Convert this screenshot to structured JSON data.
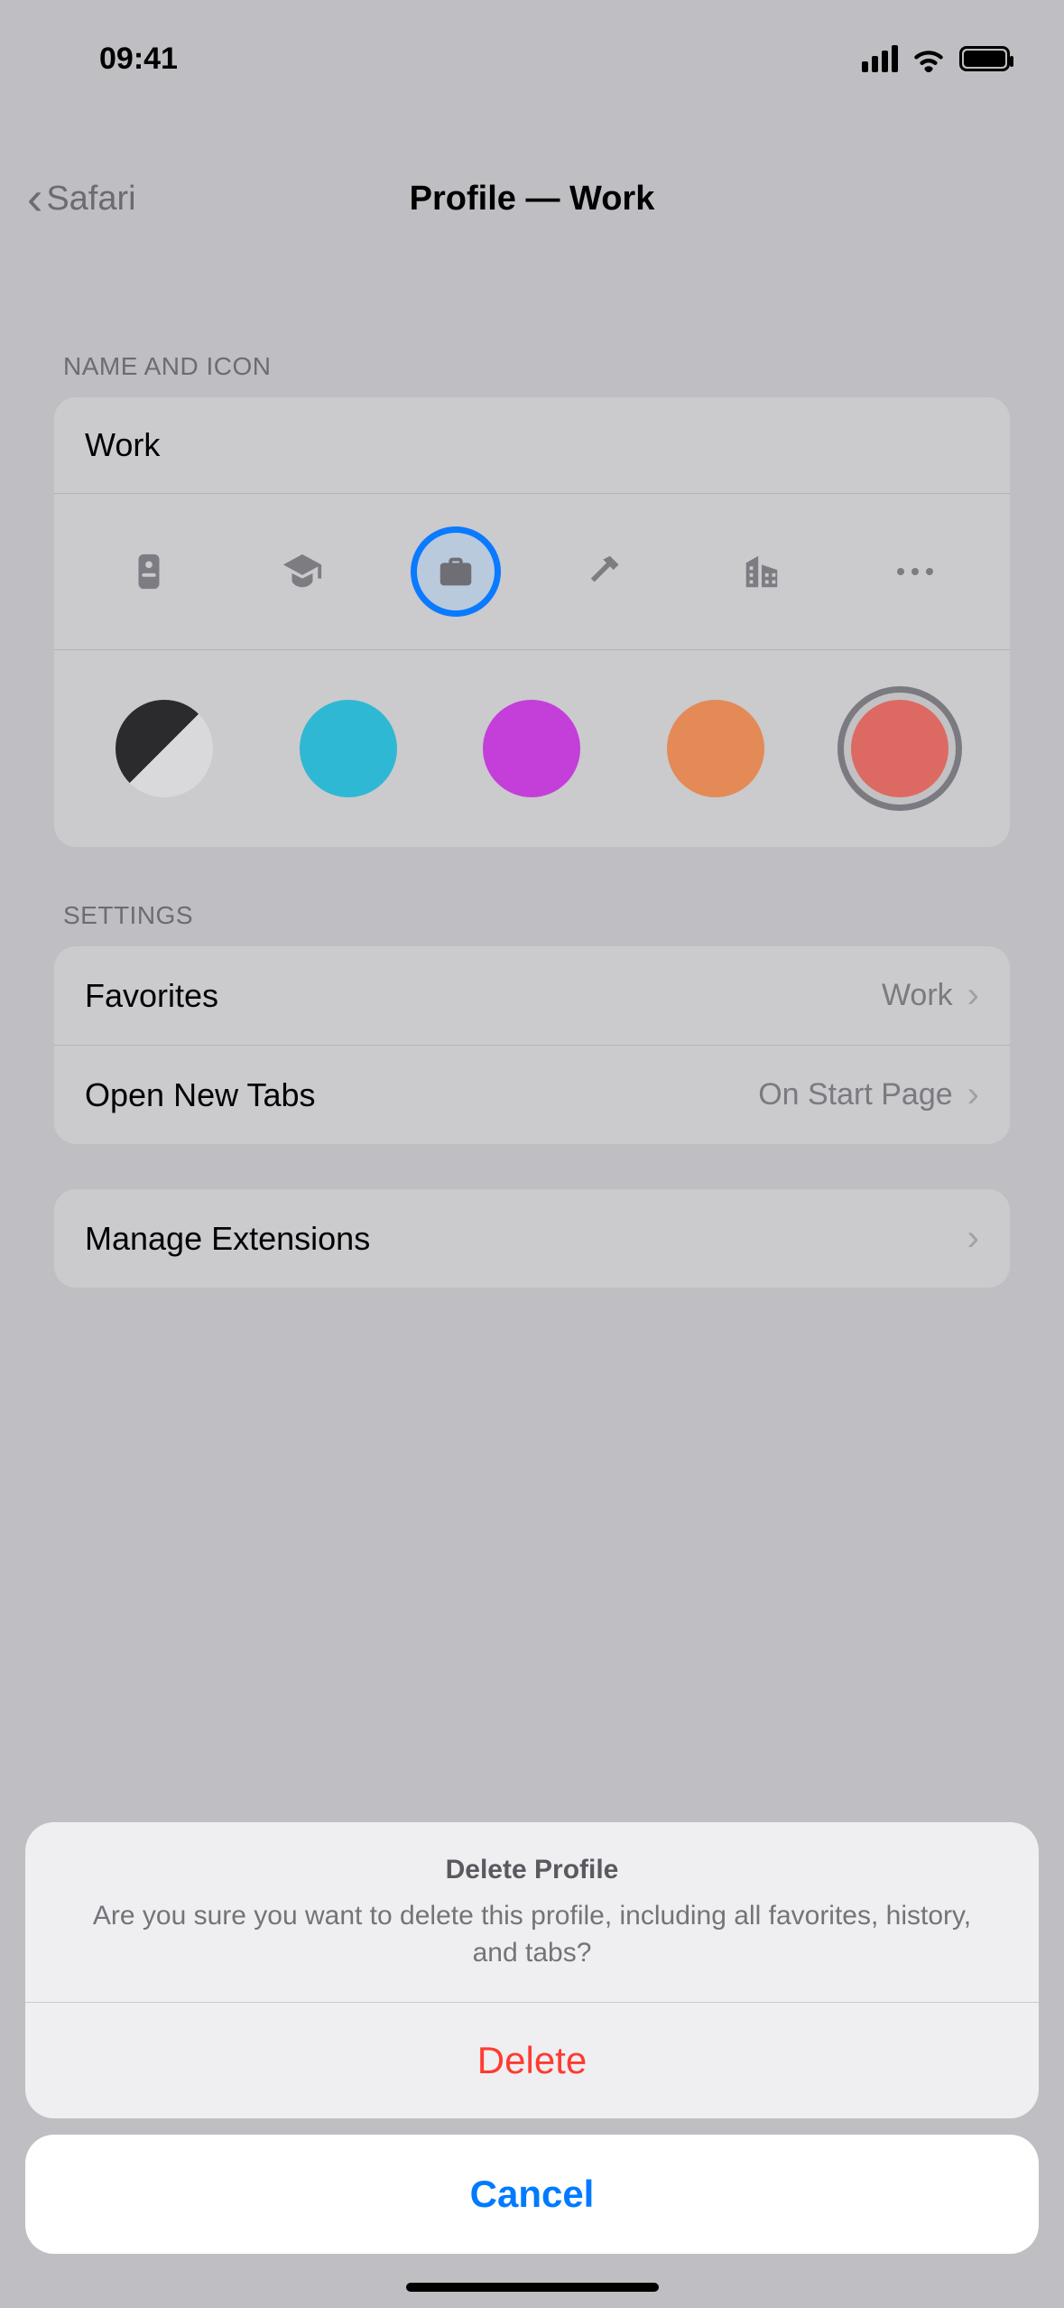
{
  "status": {
    "time": "09:41"
  },
  "nav": {
    "back_label": "Safari",
    "title": "Profile — Work"
  },
  "sections": {
    "name_icon_header": "NAME AND ICON",
    "profile_name": "Work",
    "icons": [
      {
        "id": "badge"
      },
      {
        "id": "graduation"
      },
      {
        "id": "briefcase",
        "selected": true
      },
      {
        "id": "hammer"
      },
      {
        "id": "building"
      },
      {
        "id": "more"
      }
    ],
    "colors": [
      {
        "id": "bw"
      },
      {
        "id": "cyan",
        "hex": "#2fb8d3"
      },
      {
        "id": "purple",
        "hex": "#c43fd9"
      },
      {
        "id": "orange",
        "hex": "#e38a57"
      },
      {
        "id": "red",
        "hex": "#dd6a62",
        "selected": true
      }
    ],
    "settings_header": "SETTINGS",
    "favorites": {
      "label": "Favorites",
      "value": "Work"
    },
    "open_new_tabs": {
      "label": "Open New Tabs",
      "value": "On Start Page"
    },
    "manage_extensions": {
      "label": "Manage Extensions"
    }
  },
  "sheet": {
    "title": "Delete Profile",
    "message": "Are you sure you want to delete this profile, including all favorites, history, and tabs?",
    "delete_label": "Delete",
    "cancel_label": "Cancel"
  }
}
